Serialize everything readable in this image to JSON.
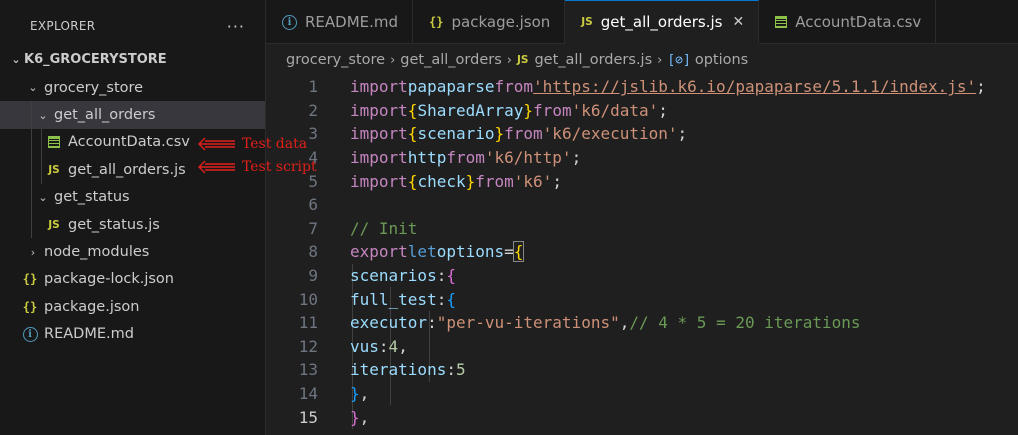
{
  "explorer": {
    "title": "EXPLORER",
    "more_label": "···",
    "project": "K6_GROCERYSTORE",
    "tree": [
      {
        "label": "grocery_store",
        "type": "folder"
      },
      {
        "label": "get_all_orders",
        "type": "folder"
      },
      {
        "label": "AccountData.csv",
        "type": "csv"
      },
      {
        "label": "get_all_orders.js",
        "type": "js"
      },
      {
        "label": "get_status",
        "type": "folder"
      },
      {
        "label": "get_status.js",
        "type": "js"
      },
      {
        "label": "node_modules",
        "type": "folder"
      },
      {
        "label": "package-lock.json",
        "type": "json"
      },
      {
        "label": "package.json",
        "type": "json"
      },
      {
        "label": "README.md",
        "type": "md"
      }
    ]
  },
  "annotations": {
    "test_data": "Test data",
    "test_script": "Test script"
  },
  "icons": {
    "js": "JS",
    "json": "{}",
    "md": "i",
    "close": "✕",
    "chev_down": "⌄",
    "chev_right": "›"
  },
  "tabs": [
    {
      "label": "README.md",
      "type": "md"
    },
    {
      "label": "package.json",
      "type": "json"
    },
    {
      "label": "get_all_orders.js",
      "type": "js",
      "active": true
    },
    {
      "label": "AccountData.csv",
      "type": "csv"
    }
  ],
  "breadcrumb": {
    "items": [
      "grocery_store",
      "get_all_orders",
      "get_all_orders.js",
      "options"
    ],
    "symbol_glyph": "[⊘]"
  },
  "code": {
    "line_numbers": [
      "1",
      "2",
      "3",
      "4",
      "5",
      "6",
      "7",
      "8",
      "9",
      "10",
      "11",
      "12",
      "13",
      "14",
      "15"
    ],
    "current_line": 15,
    "tokens": {
      "import": "import",
      "from": "from",
      "export": "export",
      "let": "let",
      "papaparse": "papaparse",
      "url": "'https://jslib.k6.io/papaparse/5.1.1/index.js'",
      "SharedArray": "SharedArray",
      "k6data": "'k6/data'",
      "scenario": "scenario",
      "k6exec": "'k6/execution'",
      "http": "http",
      "k6http": "'k6/http'",
      "check": "check",
      "k6": "'k6'",
      "comment_init": "// Init",
      "options": "options",
      "scenarios": "scenarios",
      "full_test": "full_test",
      "executor": "executor",
      "executor_val": "\"per-vu-iterations\"",
      "comment_iter": "// 4 * 5 = 20 iterations",
      "vus": "vus",
      "vus_val": "4",
      "iterations": "iterations",
      "iterations_val": "5"
    }
  },
  "colors": {
    "accent": "#0078d4",
    "annotation": "#e0201b"
  }
}
